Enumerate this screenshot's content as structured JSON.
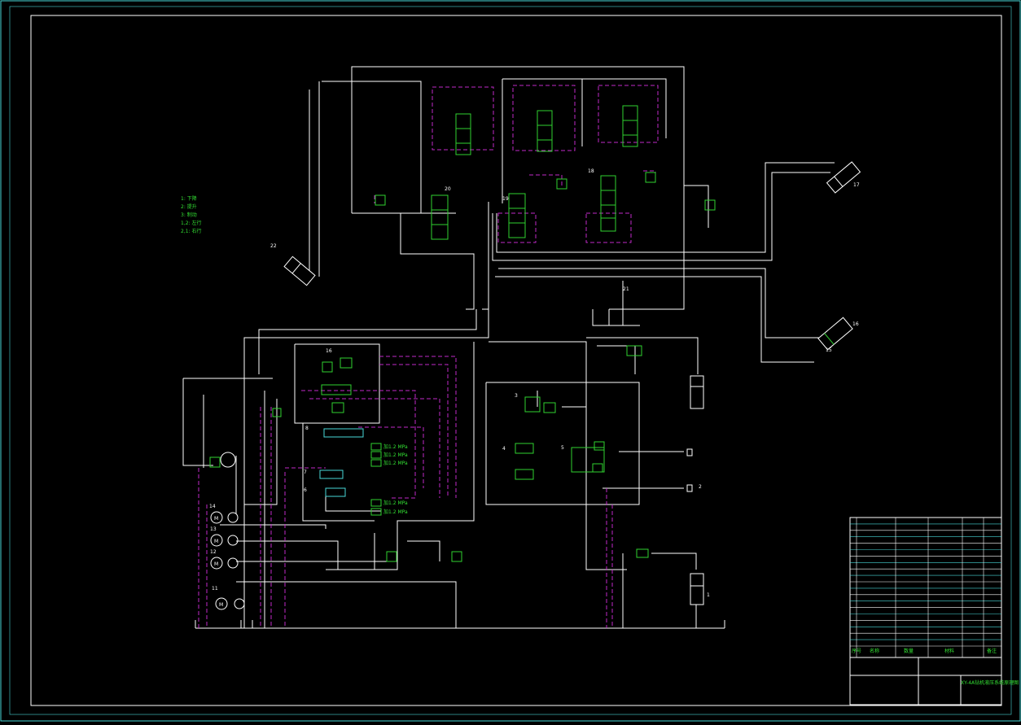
{
  "drawing": {
    "legend": [
      {
        "code": "1:",
        "text": "下降"
      },
      {
        "code": "2:",
        "text": "提升"
      },
      {
        "code": "3:",
        "text": "制动"
      },
      {
        "code": "1,2:",
        "text": "左行"
      },
      {
        "code": "2,1:",
        "text": "右行"
      }
    ],
    "components": {
      "c1": "1",
      "c2": "2",
      "c3": "3",
      "c4": "4",
      "c5": "5",
      "c6": "6",
      "c7": "7",
      "c8": "8",
      "c11": "11",
      "c12": "12",
      "c13": "13",
      "c14": "14",
      "c15": "15",
      "c16": "16",
      "c17": "17",
      "c18": "18",
      "c19": "19",
      "c20": "20",
      "c21": "21",
      "c22": "22"
    },
    "gauges": [
      "加1.2 MPa",
      "加1.2 MPa",
      "加1.2 MPa",
      "加1.2 MPa",
      "加1.2 MPa"
    ],
    "title_block": {
      "drawing_title": "XY-4A钻机液压系统原理图",
      "rows": 20,
      "headers": [
        "序号",
        "名称",
        "数量",
        "材料",
        "备注"
      ]
    }
  },
  "colors": {
    "background": "#000000",
    "line": "#ffffff",
    "pilot": "#c02ac8",
    "valve": "#2fd22f",
    "frame": "#48d8d8"
  }
}
